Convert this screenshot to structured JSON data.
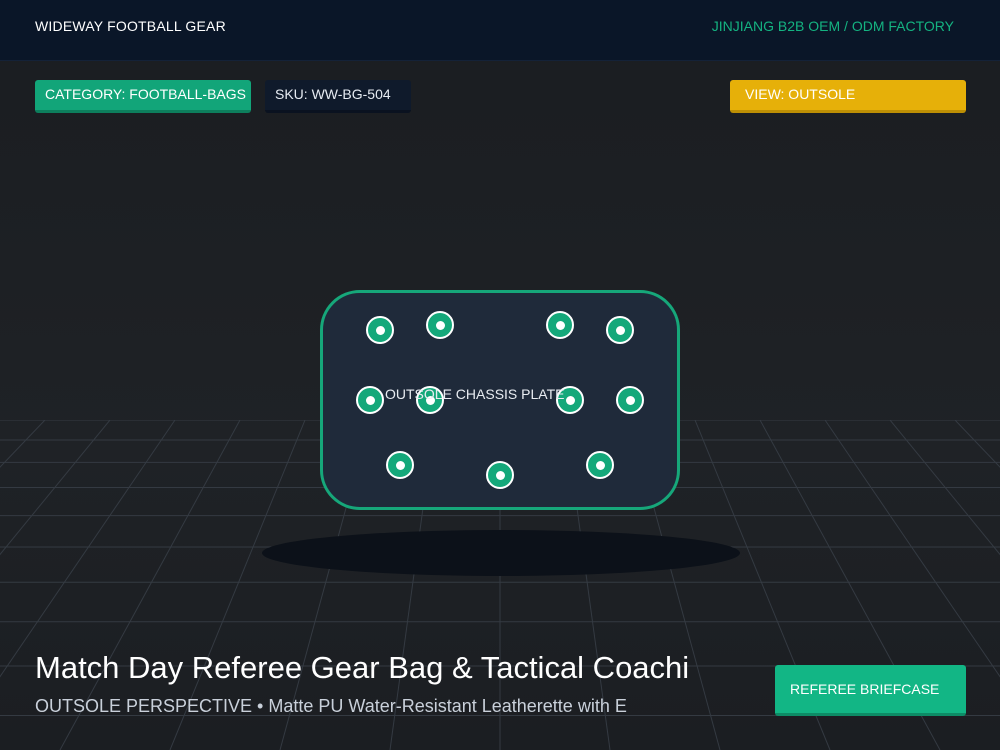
{
  "header": {
    "brand": "WIDEWAY FOOTBALL GEAR",
    "factory": "JINJIANG B2B OEM / ODM FACTORY"
  },
  "chips": {
    "category": "CATEGORY: FOOTBALL-BAGS",
    "sku": "SKU: WW-BG-504",
    "view": "VIEW: OUTSOLE"
  },
  "viewer": {
    "plate_label": "OUTSOLE CHASSIS PLATE"
  },
  "product": {
    "title": "Match Day Referee Gear Bag & Tactical Coachi",
    "subtitle": "OUTSOLE PERSPECTIVE • Matte PU Water-Resistant Leatherette with E"
  },
  "cta": {
    "label": "REFEREE BRIEFCASE"
  },
  "colors": {
    "accent_green": "#14b381",
    "accent_yellow": "#e6b009",
    "header_bg": "#0a1628"
  }
}
